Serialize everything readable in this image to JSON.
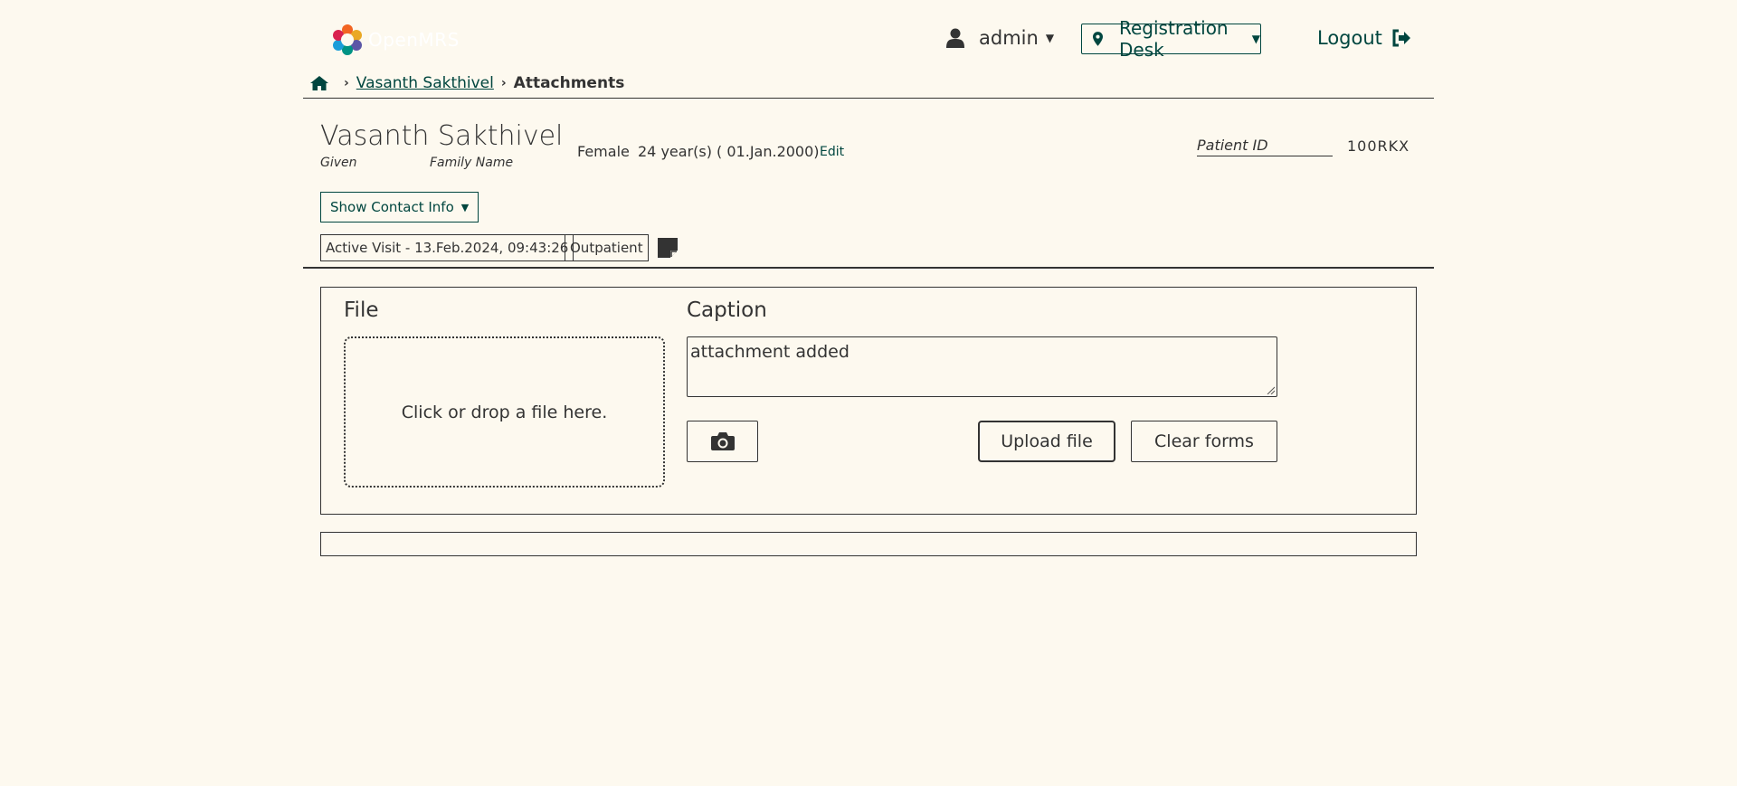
{
  "header": {
    "logo_text": "OpenMRS",
    "user": "admin",
    "location": "Registration Desk",
    "logout": "Logout"
  },
  "breadcrumb": {
    "patient": "Vasanth Sakthivel",
    "current": "Attachments"
  },
  "patient": {
    "name": "Vasanth Sakthivel",
    "given_label": "Given",
    "family_label": "Family Name",
    "gender": "Female",
    "age": "24 year(s) ( 01.Jan.2000)",
    "edit": "Edit",
    "id_label": "Patient ID",
    "id_value": "100RKX",
    "contact_toggle": "Show Contact Info",
    "visit": "Active Visit - 13.Feb.2024, 09:43:26",
    "visit_type": "Outpatient"
  },
  "upload": {
    "file_label": "File",
    "dropzone_text": "Click or drop a file here.",
    "caption_label": "Caption",
    "caption_value": "attachment added",
    "upload_button": "Upload file",
    "clear_button": "Clear forms"
  },
  "colors": {
    "background": "#fdf9ef",
    "accent": "#00463f",
    "text": "#333333"
  }
}
